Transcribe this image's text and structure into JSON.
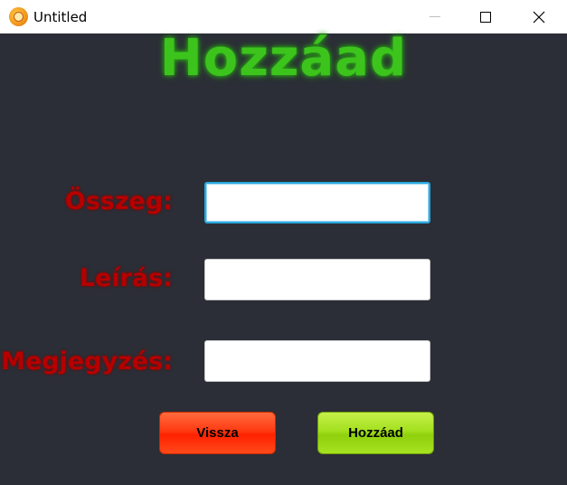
{
  "window": {
    "title": "Untitled",
    "controls": [
      "minimize",
      "maximize",
      "close"
    ]
  },
  "form": {
    "heading": "Hozzáad",
    "fields": [
      {
        "label": "Összeg:",
        "value": ""
      },
      {
        "label": "Leírás:",
        "value": ""
      },
      {
        "label": "Megjegyzés:",
        "value": ""
      }
    ]
  },
  "buttons": {
    "back_label": "Vissza",
    "add_label": "Hozzáad"
  },
  "colors": {
    "background": "#2b2e36",
    "heading": "#3cc41d",
    "label": "#b50000",
    "back_button": "#ff3a12",
    "add_button": "#a3e01e",
    "focus_border": "#29a8e0"
  },
  "icons": {
    "app": "app-icon",
    "minimize": "minimize-icon",
    "maximize": "maximize-icon",
    "close": "close-icon"
  }
}
